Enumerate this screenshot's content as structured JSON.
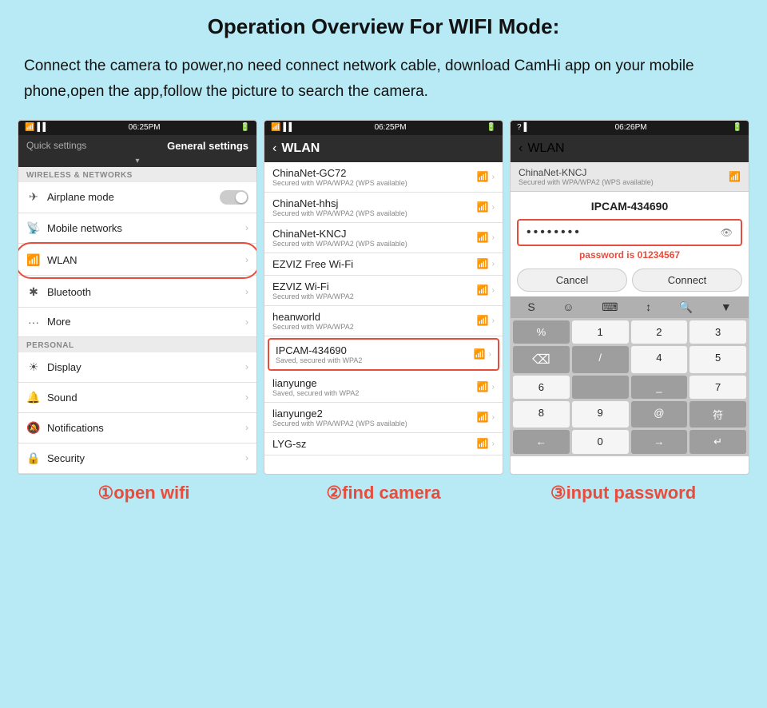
{
  "page": {
    "title": "Operation Overview For WIFI Mode:",
    "description": "Connect the camera to power,no need connect network cable, download CamHi app on your mobile phone,open the app,follow the picture to search the camera.",
    "bg_color": "#b8eaf5"
  },
  "screen1": {
    "status_time": "06:25PM",
    "tab_quick": "Quick settings",
    "tab_general": "General settings",
    "section_wireless": "WIRELESS & NETWORKS",
    "airplane_mode": "Airplane mode",
    "mobile_networks": "Mobile networks",
    "wlan": "WLAN",
    "bluetooth": "Bluetooth",
    "more": "More",
    "section_personal": "PERSONAL",
    "display": "Display",
    "sound": "Sound",
    "notifications": "Notifications",
    "security": "Security"
  },
  "screen2": {
    "status_time": "06:25PM",
    "back_label": "‹",
    "title": "WLAN",
    "networks": [
      {
        "name": "ChinaNet-GC72",
        "sub": "Secured with WPA/WPA2 (WPS available)"
      },
      {
        "name": "ChinaNet-hhsj",
        "sub": "Secured with WPA/WPA2 (WPS available)"
      },
      {
        "name": "ChinaNet-KNCJ",
        "sub": "Secured with WPA/WPA2 (WPS available)"
      },
      {
        "name": "EZVIZ Free Wi-Fi",
        "sub": ""
      },
      {
        "name": "EZVIZ Wi-Fi",
        "sub": "Secured with WPA/WPA2"
      },
      {
        "name": "heanworld",
        "sub": "Secured with WPA/WPA2"
      },
      {
        "name": "IPCAM-434690",
        "sub": "Saved, secured with WPA2",
        "highlight": true
      },
      {
        "name": "lianyunge",
        "sub": "Saved, secured with WPA2"
      },
      {
        "name": "lianyunge2",
        "sub": "Secured with WPA/WPA2 (WPS available)"
      },
      {
        "name": "LYG-sz",
        "sub": ""
      }
    ]
  },
  "screen3": {
    "status_time": "06:26PM",
    "back_label": "‹",
    "title": "WLAN",
    "secured_label": "Secured with WPA/WPA2 (WPS available)",
    "network_above": "ChinaNet-KNCJ",
    "network_above_sub": "Secured with WPA/WPA2 (WPS ...",
    "ipcam_name": "IPCAM-434690",
    "password_dots": "••••••••",
    "password_hint": "password is 01234567",
    "cancel_label": "Cancel",
    "connect_label": "Connect",
    "keyboard": {
      "top_icons": [
        "S",
        "😊",
        "⌨",
        "↕",
        "🔍",
        "▼"
      ],
      "rows": [
        [
          "%",
          "1",
          "2",
          "3",
          "⌫"
        ],
        [
          "/",
          "4",
          "5",
          "6",
          ""
        ],
        [
          "_",
          "7",
          "8",
          "9",
          "@"
        ],
        [
          "+",
          "符",
          "←",
          "0",
          "↵",
          "→"
        ]
      ]
    }
  },
  "labels": {
    "step1": "①open wifi",
    "step2": "②find camera",
    "step3": "③input password"
  }
}
